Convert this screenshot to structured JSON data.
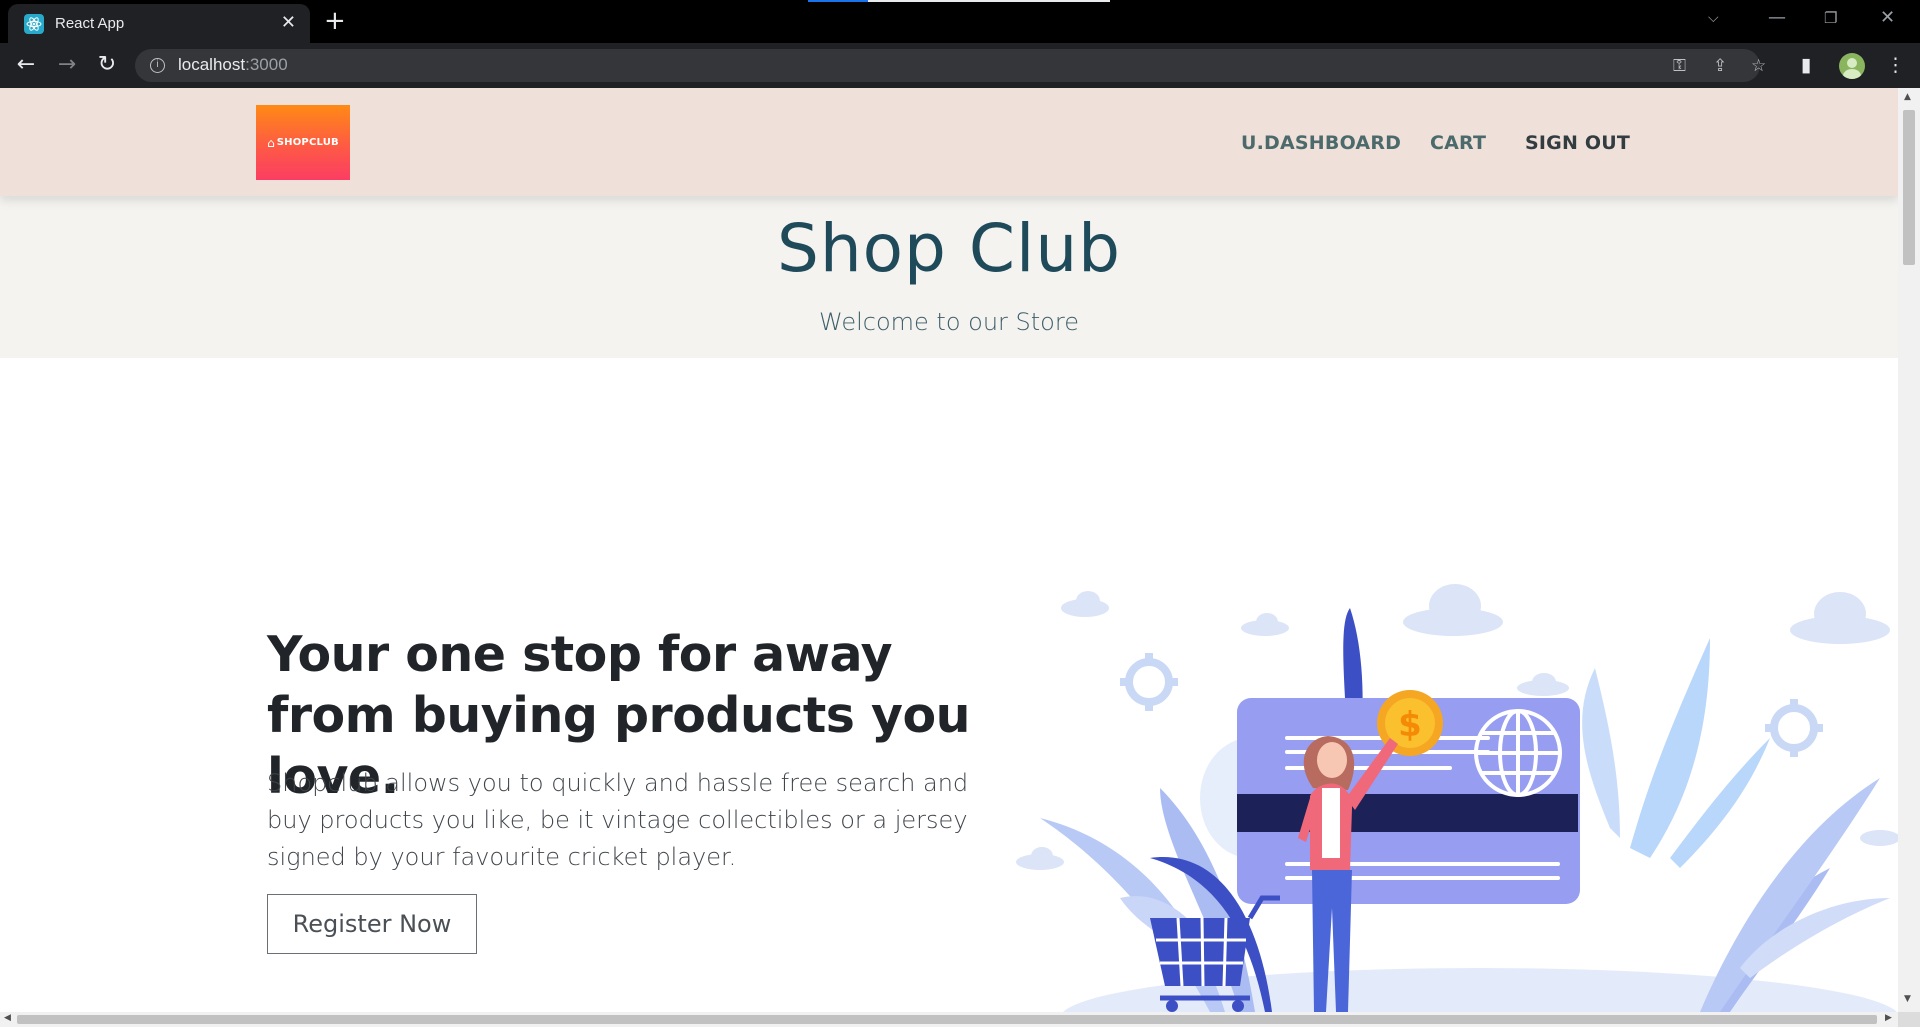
{
  "browser": {
    "tab_title": "React App",
    "url_host": "localhost",
    "url_port": ":3000"
  },
  "site": {
    "logo_text": "SHOPCLUB",
    "nav": [
      {
        "label": "U.DASHBOARD"
      },
      {
        "label": "CART"
      },
      {
        "label": "SIGN OUT"
      }
    ],
    "title": "Shop Club",
    "subtitle": "Welcome to our Store"
  },
  "main": {
    "headline": "Your one stop for away from buying products you love.",
    "body": "Shopclub allows you to quickly and hassle free search and buy products you like, be it vintage collectibles or a jersey signed by your favourite cricket player.",
    "cta_label": "Register Now"
  },
  "colors": {
    "header_bg": "#efe0d9",
    "hero_bg": "#f4f3f0",
    "title": "#1f4a5a",
    "nav": "#4c6a6b",
    "card": "#979df0",
    "card_stripe": "#1c2157",
    "coin": "#f5a623",
    "plant_dark": "#3d4fc4",
    "plant_light": "#b8c9f5"
  },
  "icons": {
    "favicon": "react-icon",
    "close": "close-icon",
    "new_tab": "plus-icon",
    "back": "arrow-left-icon",
    "forward": "arrow-right-icon",
    "reload": "reload-icon",
    "info": "info-icon",
    "key": "key-icon",
    "share": "share-icon",
    "star": "star-icon",
    "side_panel": "side-panel-icon",
    "menu": "kebab-menu-icon"
  }
}
